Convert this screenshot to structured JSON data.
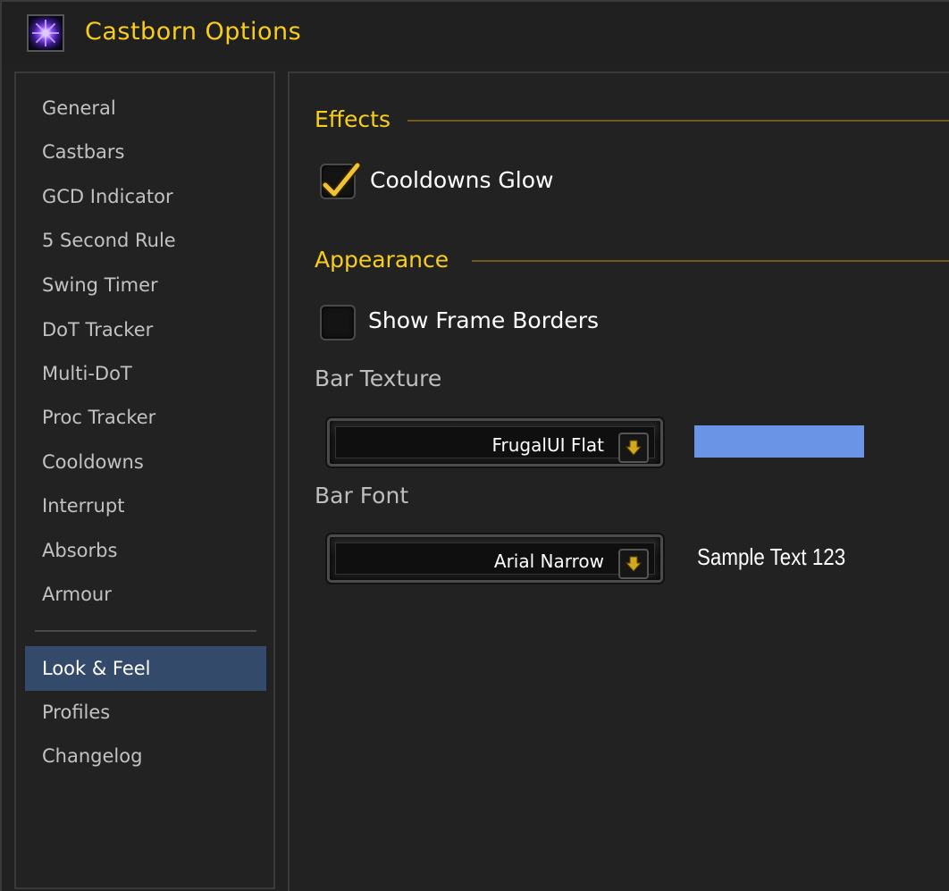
{
  "window": {
    "title": "Castborn Options"
  },
  "sidebar": {
    "items": [
      {
        "label": "General"
      },
      {
        "label": "Castbars"
      },
      {
        "label": "GCD Indicator"
      },
      {
        "label": "5 Second Rule"
      },
      {
        "label": "Swing Timer"
      },
      {
        "label": "DoT Tracker"
      },
      {
        "label": "Multi-DoT"
      },
      {
        "label": "Proc Tracker"
      },
      {
        "label": "Cooldowns"
      },
      {
        "label": "Interrupt"
      },
      {
        "label": "Absorbs"
      },
      {
        "label": "Armour"
      }
    ],
    "bottom_items": [
      {
        "label": "Look & Feel",
        "active": true
      },
      {
        "label": "Profiles"
      },
      {
        "label": "Changelog"
      }
    ]
  },
  "main": {
    "effects": {
      "header": "Effects",
      "cooldowns_glow": {
        "label": "Cooldowns Glow",
        "checked": true
      }
    },
    "appearance": {
      "header": "Appearance",
      "show_frame_borders": {
        "label": "Show Frame Borders",
        "checked": false
      },
      "bar_texture": {
        "label": "Bar Texture",
        "value": "FrugalUI Flat",
        "preview_color": "#6a95e6"
      },
      "bar_font": {
        "label": "Bar Font",
        "value": "Arial Narrow",
        "sample_text": "Sample Text 123"
      }
    }
  },
  "colors": {
    "accent_gold": "#f8cd1c",
    "active_nav": "#344a6a",
    "text_primary": "#ffffff",
    "text_muted": "#c2c2c2"
  },
  "icons": {
    "app": "purple-arcane-star-icon",
    "check": "gold-checkmark-icon",
    "dropdown": "gold-down-arrow-icon"
  }
}
